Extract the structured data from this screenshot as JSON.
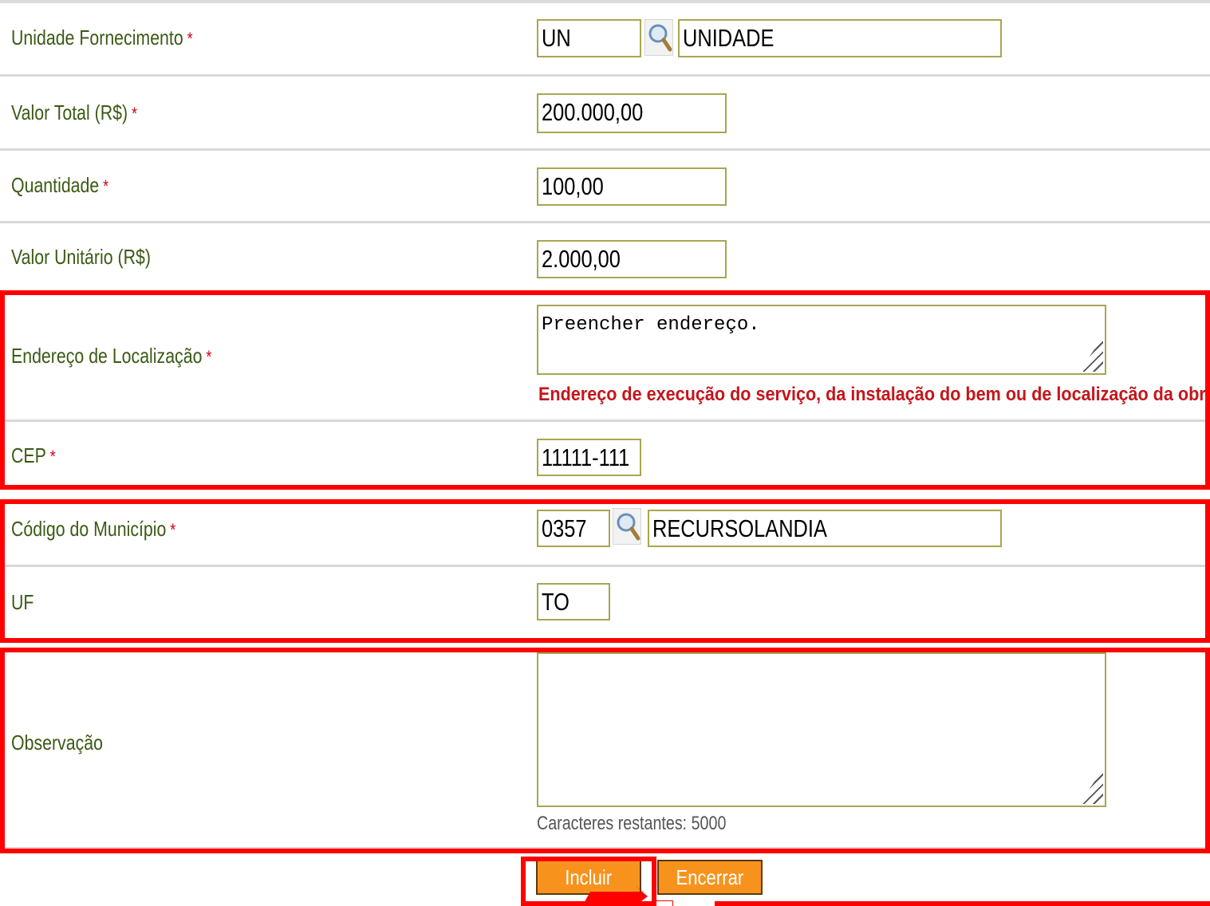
{
  "form": {
    "unidade_fornecimento": {
      "label": "Unidade Fornecimento",
      "code": "UN",
      "description": "UNIDADE"
    },
    "valor_total": {
      "label": "Valor Total (R$)",
      "value": "200.000,00"
    },
    "quantidade": {
      "label": "Quantidade",
      "value": "100,00"
    },
    "valor_unitario": {
      "label": "Valor Unitário (R$)",
      "value": "2.000,00"
    },
    "endereco": {
      "label": "Endereço de Localização",
      "value": "Preencher endereço.",
      "hint": "Endereço de execução do serviço, da instalação do bem ou de localização da obra"
    },
    "cep": {
      "label": "CEP",
      "value": "11111-111"
    },
    "municipio": {
      "label": "Código do Município",
      "code": "0357",
      "name": "RECURSOLANDIA"
    },
    "uf": {
      "label": "UF",
      "value": "TO"
    },
    "observacao": {
      "label": "Observação",
      "value": "",
      "counter_label": "Caracteres restantes:",
      "counter_value": "5000"
    },
    "required_marker": "*"
  },
  "buttons": {
    "incluir": "Incluir",
    "encerrar": "Encerrar"
  },
  "icons": {
    "lookup": "magnifier-search-icon",
    "resize": "resize-grip-icon"
  },
  "colors": {
    "label": "#3b5a14",
    "highlight": "#ff0000",
    "button": "#f7931d",
    "field_border": "#a8a650",
    "hint": "#c4161c"
  }
}
